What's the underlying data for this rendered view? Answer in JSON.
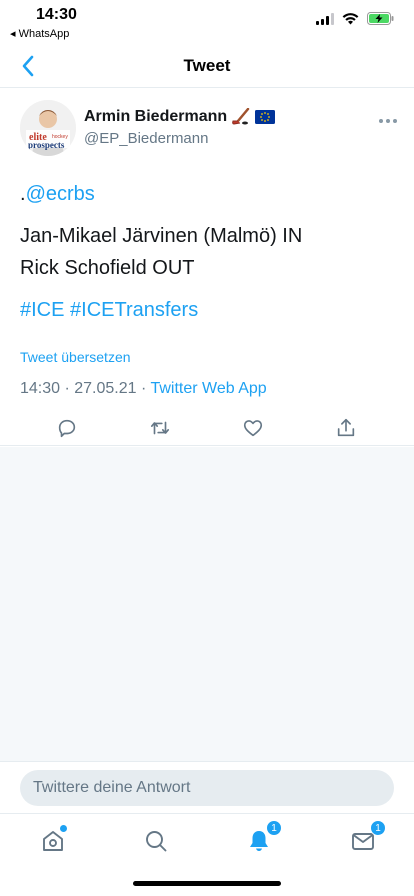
{
  "status_bar": {
    "time": "14:30",
    "back_app": "◂ WhatsApp",
    "battery_color": "#4cd964"
  },
  "nav": {
    "title": "Tweet"
  },
  "tweet": {
    "author_name": "Armin Biedermann",
    "author_emojis": [
      "hockey-stick-icon",
      "eu-flag-icon"
    ],
    "author_handle": "@EP_Biedermann",
    "avatar_logo": {
      "line1": "elite",
      "line1b": "hockey",
      "line2": "prospects"
    },
    "text": {
      "mention_prefix": ".",
      "mention": "@ecrbs",
      "line1": "Jan-Mikael Järvinen (Malmö) IN",
      "line2": "Rick Schofield OUT",
      "hashtag1": "#ICE",
      "hashtag2": "#ICETransfers"
    },
    "translate_label": "Tweet übersetzen",
    "timestamp": "14:30 · 27.05.21 · ",
    "source_app": "Twitter Web App"
  },
  "actions": [
    "reply-icon",
    "retweet-icon",
    "like-icon",
    "share-icon"
  ],
  "reply": {
    "placeholder": "Twittere deine Antwort"
  },
  "tab_bar": {
    "notifications_badge": "1",
    "messages_badge": "1"
  },
  "colors": {
    "accent": "#1da1f2",
    "secondary_text": "#657786",
    "divider": "#e6ecf0",
    "timeline_bg": "#f5f8fa"
  }
}
